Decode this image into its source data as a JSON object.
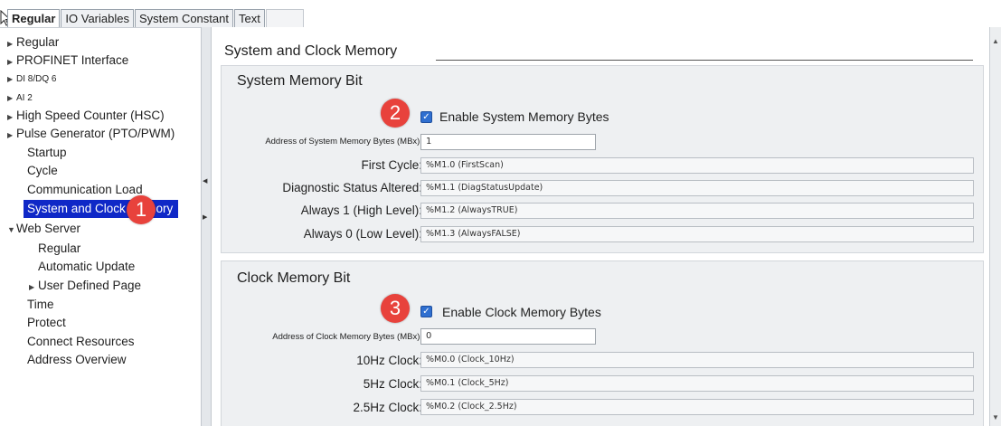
{
  "tabs": [
    {
      "label": "Regular",
      "active": true
    },
    {
      "label": "IO Variables"
    },
    {
      "label": "System Constant"
    },
    {
      "label": "Text"
    }
  ],
  "tree": {
    "items": [
      {
        "label": "Regular"
      },
      {
        "label": "PROFINET Interface"
      },
      {
        "label": "DI 8/DQ 6"
      },
      {
        "label": "AI 2"
      },
      {
        "label": "High Speed Counter (HSC)"
      },
      {
        "label": "Pulse Generator (PTO/PWM)"
      },
      {
        "label": "Startup"
      },
      {
        "label": "Cycle"
      },
      {
        "label": "Communication Load"
      },
      {
        "label": "System and Clock Memory",
        "selected": true
      },
      {
        "label": "Web Server"
      },
      {
        "label": "Regular"
      },
      {
        "label": "Automatic Update"
      },
      {
        "label": "User Defined Page"
      },
      {
        "label": "Time"
      },
      {
        "label": "Protect"
      },
      {
        "label": "Connect Resources"
      },
      {
        "label": "Address Overview"
      }
    ]
  },
  "content": {
    "title": "System and Clock Memory",
    "system_memory": {
      "title": "System Memory Bit",
      "enable_label": "Enable System Memory Bytes",
      "enabled": true,
      "address_label": "Address of System Memory Bytes (MBx):",
      "address_value": "1",
      "rows": [
        {
          "label": "First Cycle:",
          "value": "%M1.0 (FirstScan)"
        },
        {
          "label": "Diagnostic Status Altered:",
          "value": "%M1.1 (DiagStatusUpdate)"
        },
        {
          "label": "Always 1 (High Level):",
          "value": "%M1.2 (AlwaysTRUE)"
        },
        {
          "label": "Always 0 (Low Level):",
          "value": "%M1.3 (AlwaysFALSE)"
        }
      ]
    },
    "clock_memory": {
      "title": "Clock Memory Bit",
      "enable_label": "Enable Clock Memory Bytes",
      "enabled": true,
      "address_label": "Address of Clock Memory Bytes (MBx):",
      "address_value": "0",
      "rows": [
        {
          "label": "10Hz Clock:",
          "value": "%M0.0 (Clock_10Hz)"
        },
        {
          "label": "5Hz Clock:",
          "value": "%M0.1 (Clock_5Hz)"
        },
        {
          "label": "2.5Hz Clock:",
          "value": "%M0.2 (Clock_2.5Hz)"
        }
      ]
    }
  },
  "callouts": {
    "one": "1",
    "two": "2",
    "three": "3",
    "color": "#e8423c"
  },
  "colors": {
    "selection": "#0f28c7",
    "panel": "#eef0f2"
  },
  "icons": {
    "cursor": "arrow-cursor-icon",
    "expand": "triangle-right-icon",
    "collapse": "triangle-down-icon",
    "check": "checkmark-icon"
  }
}
